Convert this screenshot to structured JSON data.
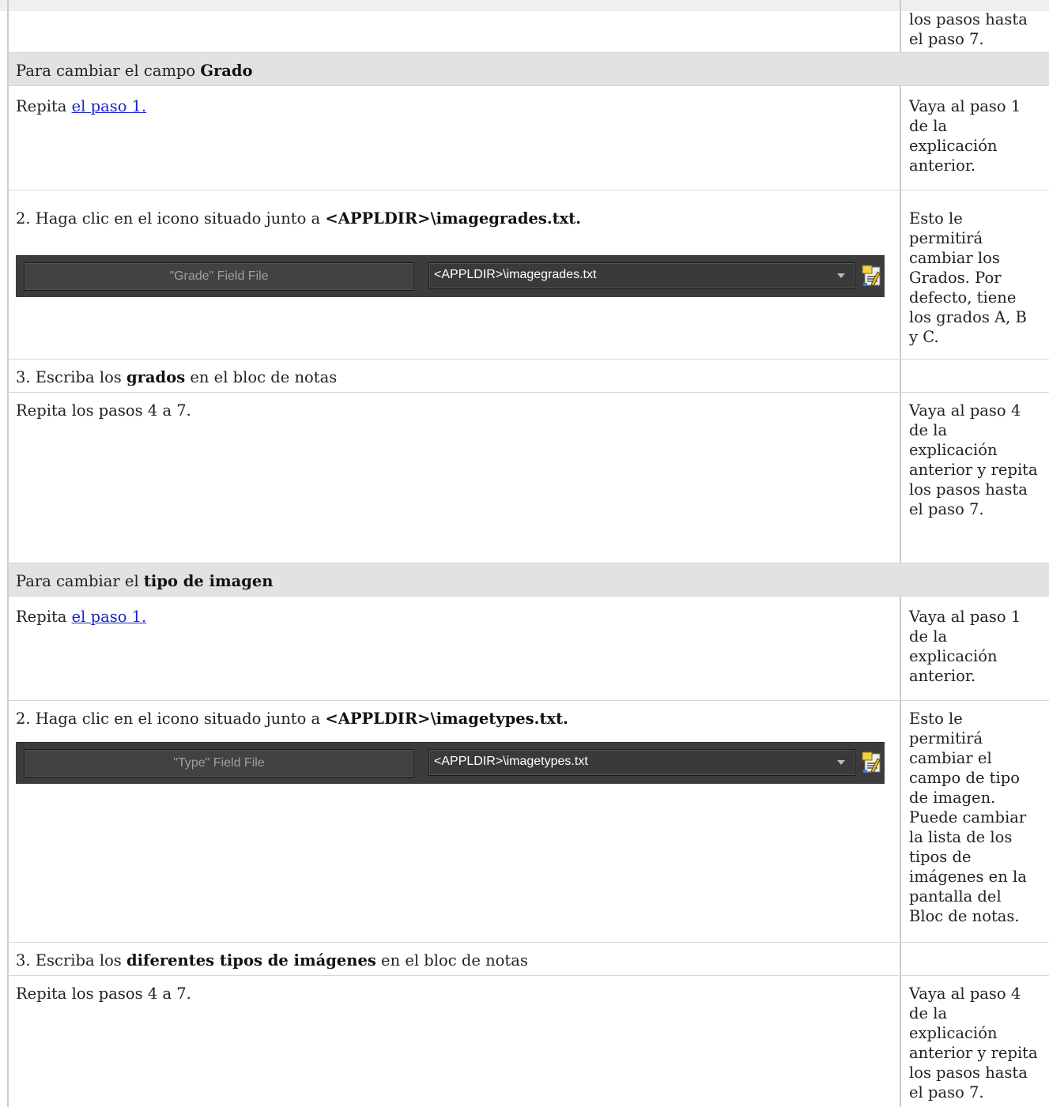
{
  "top_row": {
    "side_lines": [
      "los pasos hasta",
      "el paso 7."
    ]
  },
  "grade_section": {
    "header_prefix": "Para cambiar el campo ",
    "header_bold": "Grado",
    "step1_prefix": "Repita ",
    "step1_link": "el paso 1.",
    "step1_side": [
      "Vaya al paso 1",
      "de la",
      "explicación",
      "anterior."
    ],
    "step2_prefix": "2. Haga clic en el icono situado junto a ",
    "step2_bold": "<APPLDIR>\\imagegrades.txt.",
    "field_label": "\"Grade\" Field File",
    "field_value": "<APPLDIR>\\imagegrades.txt",
    "step2_side": [
      "Esto le",
      "permitirá",
      "cambiar los",
      "Grados. Por",
      "defecto, tiene",
      "los grados A, B",
      "y C."
    ],
    "step3_prefix": "3. Escriba los ",
    "step3_bold": "grados",
    "step3_suffix": " en el bloc de notas",
    "repeat_text": "Repita los pasos 4 a 7.",
    "repeat_side": [
      "Vaya al paso 4",
      "de la",
      "explicación",
      "anterior y repita",
      "los pasos hasta",
      "el paso 7."
    ]
  },
  "type_section": {
    "header_prefix": "Para cambiar el ",
    "header_bold": "tipo de imagen",
    "step1_prefix": "Repita ",
    "step1_link": "el paso 1.",
    "step1_side": [
      "Vaya al paso 1",
      "de la",
      "explicación",
      "anterior."
    ],
    "step2_prefix": "2. Haga clic en el icono situado junto a ",
    "step2_bold": "<APPLDIR>\\imagetypes.txt.",
    "field_label": "\"Type\" Field File",
    "field_value": "<APPLDIR>\\imagetypes.txt",
    "step2_side": [
      "Esto le",
      "permitirá",
      "cambiar el",
      "campo de tipo",
      "de imagen.",
      "Puede cambiar",
      "la lista de los",
      "tipos de",
      "imágenes en la",
      "pantalla del",
      "Bloc de notas."
    ],
    "step3_prefix": "3. Escriba los ",
    "step3_bold": "diferentes tipos de imágenes",
    "step3_suffix": " en el bloc de notas",
    "repeat_text": "Repita los pasos 4 a 7.",
    "repeat_side": [
      "Vaya al paso 4",
      "de la",
      "explicación",
      "anterior y repita",
      "los pasos hasta",
      "el paso 7."
    ]
  }
}
